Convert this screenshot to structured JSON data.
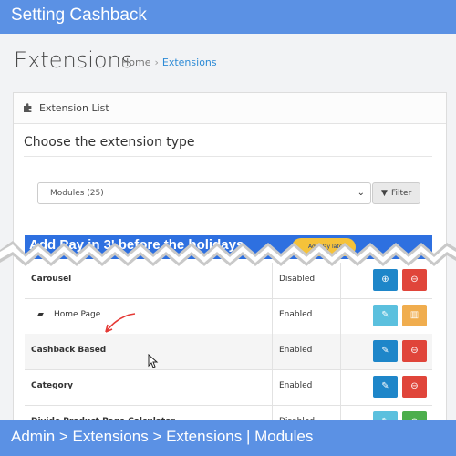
{
  "banner_top": {
    "title": "Setting Cashback"
  },
  "page": {
    "title": "Extensions",
    "breadcrumb": {
      "home": "Home",
      "sep": "›",
      "current": "Extensions"
    }
  },
  "panel": {
    "title": "Extension List",
    "title_icon": "puzzle-icon",
    "subtitle": "Choose the extension type",
    "select_value": "Modules (25)",
    "filter_label": "Filter",
    "filter_icon": "filter-icon"
  },
  "ad": {
    "text": "Add Pay in 3' before the holidays",
    "badge": "Add Pay later"
  },
  "rows": [
    {
      "name": "Carousel",
      "status": "Disabled",
      "bold": true,
      "btn1": {
        "icon": "plus-icon",
        "glyph": "⊕",
        "color": "#1e86c9"
      },
      "btn2": {
        "icon": "minus-icon",
        "glyph": "⊖",
        "color": "#e0453a"
      }
    },
    {
      "name": "Home Page",
      "status": "Enabled",
      "bold": false,
      "indent_icon": "folder-icon",
      "btn1": {
        "icon": "pencil-icon",
        "glyph": "✎",
        "color": "#5bc0de"
      },
      "btn2": {
        "icon": "trash-icon",
        "glyph": "🗑",
        "color": "#f0ad4e"
      }
    },
    {
      "name": "Cashback Based",
      "status": "Enabled",
      "bold": true,
      "btn1": {
        "icon": "pencil-icon",
        "glyph": "✎",
        "color": "#1e86c9"
      },
      "btn2": {
        "icon": "minus-icon",
        "glyph": "⊖",
        "color": "#e0453a"
      }
    },
    {
      "name": "Category",
      "status": "Enabled",
      "bold": true,
      "btn1": {
        "icon": "pencil-icon",
        "glyph": "✎",
        "color": "#1e86c9"
      },
      "btn2": {
        "icon": "minus-icon",
        "glyph": "⊖",
        "color": "#e0453a"
      }
    },
    {
      "name": "Divido Product Page Calculator",
      "status": "Disabled",
      "bold": true,
      "btn1": {
        "icon": "pencil-icon",
        "glyph": "✎",
        "color": "#5bc0de"
      },
      "btn2": {
        "icon": "plus-icon",
        "glyph": "⊕",
        "color": "#4cae4c"
      }
    }
  ],
  "banner_bottom": {
    "path": "Admin > Extensions > Extensions | Modules"
  },
  "colors": {
    "banner": "#5b91e4",
    "link": "#2e8bd6"
  }
}
